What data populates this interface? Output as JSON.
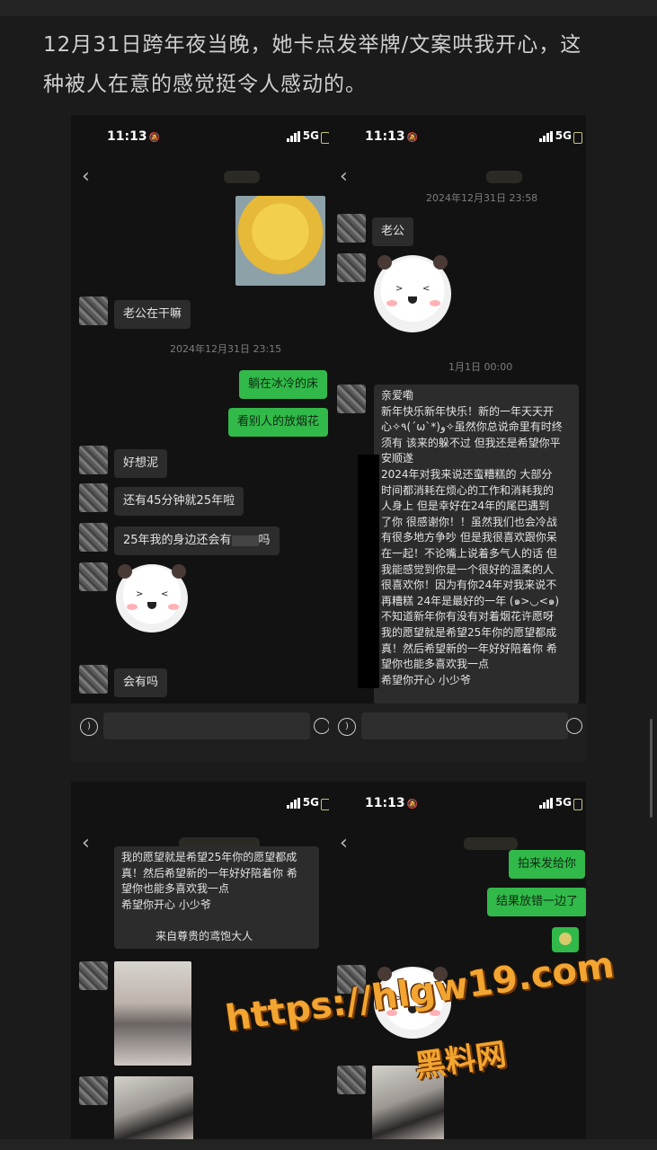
{
  "caption": {
    "line1": "12月31日跨年夜当晚，她卡点发举牌/文案哄我开心，这",
    "line2": "种被人在意的感觉挺令人感动的。"
  },
  "status": {
    "time": "11:13",
    "network": "5G"
  },
  "panel1": {
    "messages": [
      {
        "dir": "in",
        "text": "老公在干嘛"
      },
      {
        "dir": "out",
        "text": "躺在冰冷的床"
      },
      {
        "dir": "out",
        "text": "看别人的放烟花"
      },
      {
        "dir": "in",
        "text": "好想泥"
      },
      {
        "dir": "in",
        "text": "还有45分钟就25年啦"
      },
      {
        "dir": "in",
        "text": "25年我的身边还会有",
        "suffix": "吗"
      },
      {
        "dir": "in",
        "text": "会有吗"
      }
    ],
    "timestamp": "2024年12月31日 23:15"
  },
  "panel2": {
    "timestamp1": "2024年12月31日 23:58",
    "msg_laogong": "老公",
    "timestamp2": "1月1日 00:00",
    "long_msg": "亲爱嘞\n新年快乐新年快乐！新的一年天天开\n心✧٩(ˊωˋ*)و✧虽然你总说命里有时终\n须有 该来的躲不过 但我还是希望你平\n安顺遂\n2024年对我来说还蛮糟糕的 大部分\n时间都消耗在烦心的工作和消耗我的\n人身上 但是幸好在24年的尾巴遇到\n了你 很感谢你！！虽然我们也会冷战\n有很多地方争吵 但是我很喜欢跟你呆\n在一起！不论嘴上说着多气人的话 但\n我能感觉到你是一个很好的温柔的人\n很喜欢你！因为有你24年对我来说不\n再糟糕 24年是最好的一年 (๑>◡<๑)\n不知道新年你有没有对着烟花许愿呀\n我的愿望就是希望25年你的愿望都成\n真！然后希望新的一年好好陪着你 希\n望你也能多喜欢我一点\n希望你开心 小少爷"
  },
  "panel3": {
    "long_msg": "我的愿望就是希望25年你的愿望都成\n真！然后希望新的一年好好陪着你 希\n望你也能多喜欢我一点\n希望你开心 小少爷\n\n          来自尊贵的鸢饱大人"
  },
  "panel4": {
    "msg1": "拍来发给你",
    "msg2": "结果放错一边了"
  },
  "watermark": {
    "url": "https://hlgw19.com",
    "cn": "黑料网"
  }
}
